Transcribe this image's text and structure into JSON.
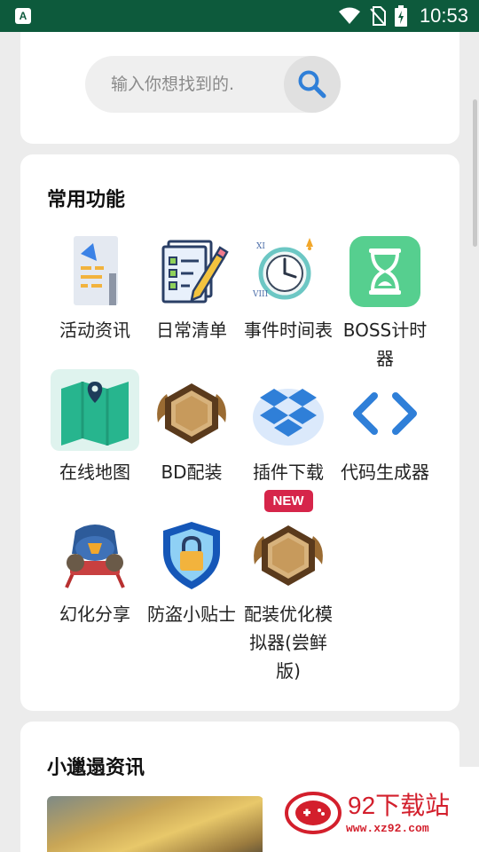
{
  "status_bar": {
    "time": "10:53",
    "app_badge": "A"
  },
  "search": {
    "placeholder": "输入你想找到的."
  },
  "common_functions": {
    "title": "常用功能",
    "items": [
      {
        "label": "活动资讯",
        "icon": "megaphone-icon"
      },
      {
        "label": "日常清单",
        "icon": "checklist-icon"
      },
      {
        "label": "事件时间表",
        "icon": "alarm-clock-icon"
      },
      {
        "label": "BOSS计时器",
        "icon": "hourglass-icon"
      },
      {
        "label": "在线地图",
        "icon": "map-icon"
      },
      {
        "label": "BD配装",
        "icon": "hexagon-wings-icon"
      },
      {
        "label": "插件下载",
        "icon": "dropbox-icon",
        "badge": "NEW"
      },
      {
        "label": "代码生成器",
        "icon": "code-brackets-icon"
      },
      {
        "label": "幻化分享",
        "icon": "character-icon"
      },
      {
        "label": "防盗小贴士",
        "icon": "shield-lock-icon"
      },
      {
        "label": "配装优化模拟器(尝鲜版)",
        "icon": "hexagon-wings-icon"
      }
    ]
  },
  "news": {
    "title": "小邋遢资讯"
  },
  "watermark": {
    "name": "92下载站",
    "url": "www.xz92.com"
  },
  "colors": {
    "status_bar": "#0d5a3c",
    "badge_new": "#d6254a",
    "watermark": "#d31f2c",
    "accent_blue": "#2f7fd8"
  }
}
